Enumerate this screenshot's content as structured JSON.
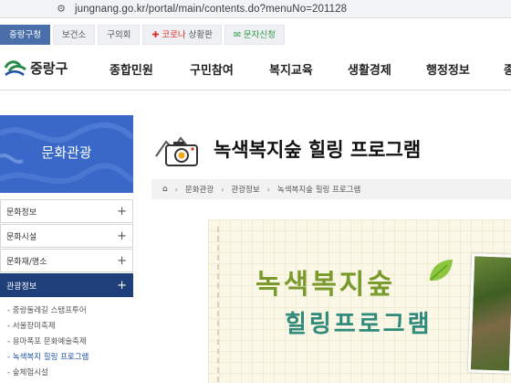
{
  "browser": {
    "url": "jungnang.go.kr/portal/main/contents.do?menuNo=201128"
  },
  "top_tabs": [
    {
      "label": "중랑구청"
    },
    {
      "label": "보건소"
    },
    {
      "label": "구의회"
    },
    {
      "label_red": "코로나",
      "label": " 상황판"
    },
    {
      "label_green": "문자신청"
    }
  ],
  "header": {
    "logo_text": "중랑구",
    "nav": [
      "종합민원",
      "구민참여",
      "복지교육",
      "생활경제",
      "행정정보",
      "종"
    ]
  },
  "sidebar": {
    "banner_title": "문화관광",
    "items": [
      {
        "label": "문화정보"
      },
      {
        "label": "문화시설"
      },
      {
        "label": "문화재/명소"
      },
      {
        "label": "관광정보"
      }
    ],
    "subitems": [
      "- 중랑둘레길 스탬프투어",
      "- 서울장미축제",
      "- 용마폭포 문화예술축제",
      "- 녹색복지 힐링 프로그램",
      "- 숲체험시설"
    ]
  },
  "main": {
    "page_title": "녹색복지숲 힐링 프로그램",
    "breadcrumb": [
      "문화관광",
      "관광정보",
      "녹색복지숲 힐링 프로그램"
    ],
    "hero_line1": "녹색복지숲",
    "hero_line2": "힐링프로그램"
  },
  "colors": {
    "accent": "#3a68c8",
    "active_menu": "#1e3f7a",
    "hero_green": "#7a9a2c",
    "hero_teal": "#2f8a7b"
  }
}
